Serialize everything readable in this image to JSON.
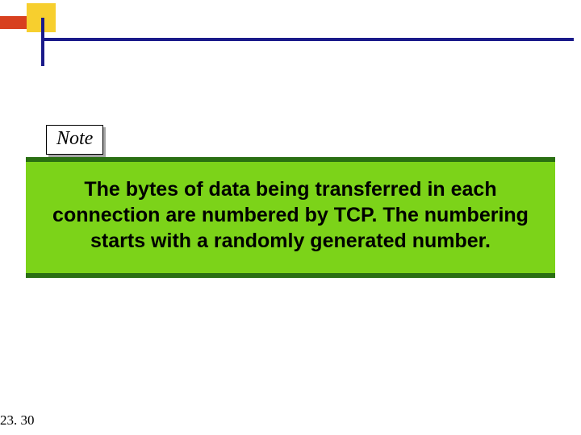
{
  "note": {
    "label": "Note"
  },
  "body": {
    "text": "The bytes of data being transferred in each connection are numbered by TCP. The numbering starts with a randomly generated number."
  },
  "page": {
    "number": "23. 30"
  },
  "colors": {
    "accent_blue": "#1a1a8a",
    "accent_yellow": "#f7cf2e",
    "accent_red": "#d8401f",
    "note_green_bg": "#7cd319",
    "note_green_border": "#2a6f12"
  }
}
